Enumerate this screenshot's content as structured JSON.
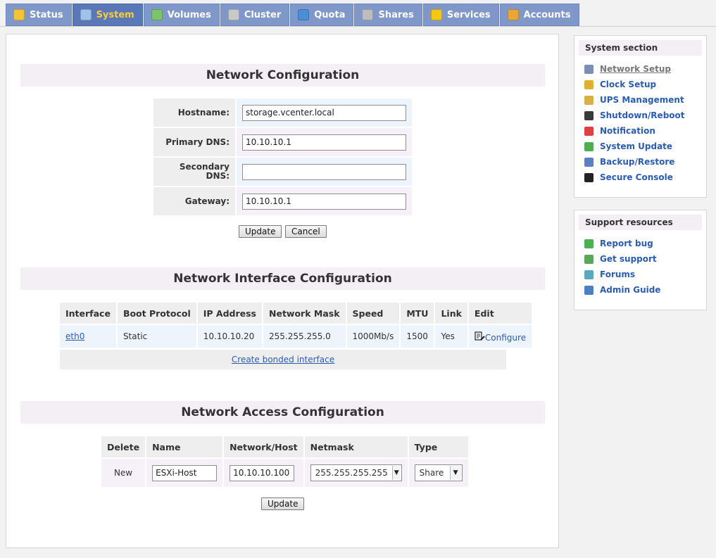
{
  "tabs": [
    {
      "label": "Status",
      "icon": "sun-cloud-icon",
      "color": "#f3c33c"
    },
    {
      "label": "System",
      "icon": "monitor-icon",
      "color": "#9fc3e8",
      "active": true
    },
    {
      "label": "Volumes",
      "icon": "disk-icon",
      "color": "#7cc36a"
    },
    {
      "label": "Cluster",
      "icon": "servers-icon",
      "color": "#c9c9c9"
    },
    {
      "label": "Quota",
      "icon": "pie-icon",
      "color": "#4a8fd6"
    },
    {
      "label": "Shares",
      "icon": "drive-icon",
      "color": "#bdbdbd"
    },
    {
      "label": "Services",
      "icon": "lightning-icon",
      "color": "#f5c518"
    },
    {
      "label": "Accounts",
      "icon": "users-icon",
      "color": "#e6a63a"
    }
  ],
  "network_config": {
    "title": "Network Configuration",
    "hostname_label": "Hostname:",
    "hostname_value": "storage.vcenter.local",
    "primary_dns_label": "Primary DNS:",
    "primary_dns_value": "10.10.10.1",
    "secondary_dns_label": "Secondary DNS:",
    "secondary_dns_value": "",
    "gateway_label": "Gateway:",
    "gateway_value": "10.10.10.1",
    "update_label": "Update",
    "cancel_label": "Cancel"
  },
  "interface_config": {
    "title": "Network Interface Configuration",
    "headers": [
      "Interface",
      "Boot Protocol",
      "IP Address",
      "Network Mask",
      "Speed",
      "MTU",
      "Link",
      "Edit"
    ],
    "row": {
      "interface": "eth0",
      "boot_protocol": "Static",
      "ip_address": "10.10.10.20",
      "network_mask": "255.255.255.0",
      "speed": "1000Mb/s",
      "mtu": "1500",
      "link": "Yes",
      "edit": "Configure"
    },
    "bonded_link": "Create bonded interface"
  },
  "access_config": {
    "title": "Network Access Configuration",
    "headers": [
      "Delete",
      "Name",
      "Network/Host",
      "Netmask",
      "Type"
    ],
    "row": {
      "delete": "New",
      "name": "ESXi-Host",
      "network_host": "10.10.10.100",
      "netmask": "255.255.255.255",
      "type": "Share"
    },
    "update_label": "Update"
  },
  "sidebar": {
    "system_title": "System section",
    "system_items": [
      {
        "label": "Network Setup",
        "icon": "wrench-icon",
        "color": "#7a8fb5",
        "current": true
      },
      {
        "label": "Clock Setup",
        "icon": "clock-icon",
        "color": "#e0b030"
      },
      {
        "label": "UPS Management",
        "icon": "battery-icon",
        "color": "#d8b04a"
      },
      {
        "label": "Shutdown/Reboot",
        "icon": "power-icon",
        "color": "#3a3a3a"
      },
      {
        "label": "Notification",
        "icon": "alert-icon",
        "color": "#e04040"
      },
      {
        "label": "System Update",
        "icon": "refresh-icon",
        "color": "#4caf50"
      },
      {
        "label": "Backup/Restore",
        "icon": "backup-icon",
        "color": "#5b7fc0"
      },
      {
        "label": "Secure Console",
        "icon": "console-icon",
        "color": "#222222"
      }
    ],
    "support_title": "Support resources",
    "support_items": [
      {
        "label": "Report bug",
        "icon": "bug-icon",
        "color": "#4caf50"
      },
      {
        "label": "Get support",
        "icon": "support-icon",
        "color": "#58a858"
      },
      {
        "label": "Forums",
        "icon": "forums-icon",
        "color": "#58a8c0"
      },
      {
        "label": "Admin Guide",
        "icon": "book-icon",
        "color": "#4a7fc0"
      }
    ]
  }
}
